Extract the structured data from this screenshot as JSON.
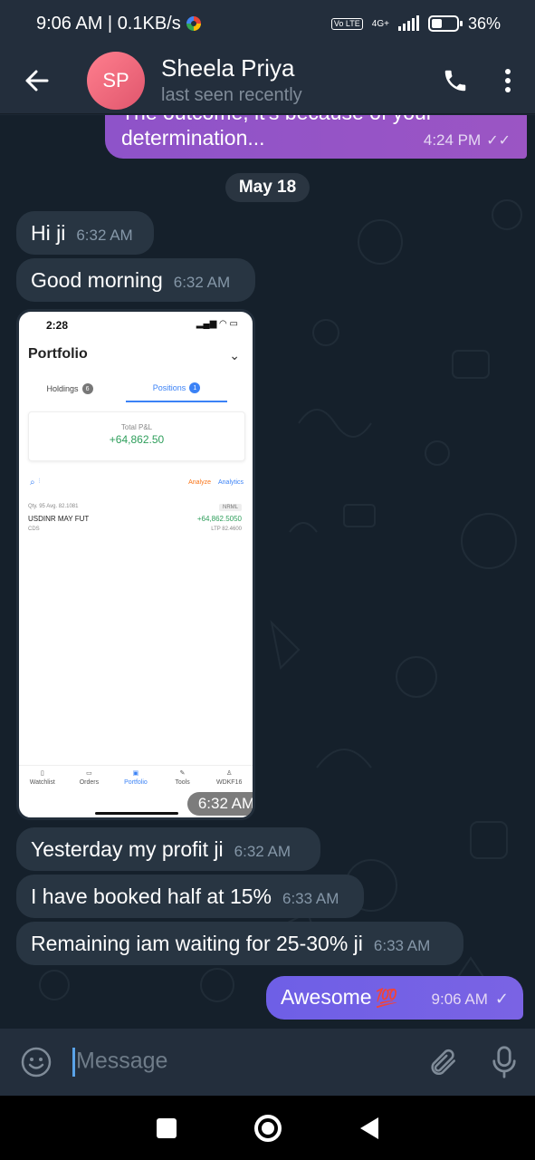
{
  "status_bar": {
    "time_speed": "9:06 AM | 0.1KB/s",
    "network_badge": "Vo LTE",
    "network_type": "4G+",
    "battery": "36%"
  },
  "header": {
    "avatar_initials": "SP",
    "name": "Sheela Priya",
    "status": "last seen recently"
  },
  "chat": {
    "prev_message": {
      "text_cut": "The outcome, it's because of your",
      "text": "determination...",
      "time": "4:24 PM"
    },
    "date_label": "May 18",
    "messages": [
      {
        "text": "Hi ji",
        "time": "6:32 AM"
      },
      {
        "text": "Good morning",
        "time": "6:32 AM"
      },
      {
        "text": "Yesterday my profit ji",
        "time": "6:32 AM"
      },
      {
        "text": "I have booked half at 15%",
        "time": "6:33 AM"
      },
      {
        "text": "Remaining iam waiting for 25-30% ji",
        "time": "6:33 AM"
      }
    ],
    "photo": {
      "time_label": "6:32 AM",
      "screen": {
        "clock": "2:28",
        "title": "Portfolio",
        "tab_holdings": "Holdings",
        "tab_holdings_count": "6",
        "tab_positions": "Positions",
        "tab_positions_count": "1",
        "pnl_label": "Total P&L",
        "pnl_value": "+64,862.50",
        "analyze": "Analyze",
        "analytics": "Analytics",
        "qty_line": "Qty. 95  Avg. 82.1081",
        "product": "NRML",
        "instrument": "USDINR MAY FUT",
        "instrument_pnl": "+64,862.5050",
        "exchange": "CDS",
        "ltp": "LTP 82.4600",
        "nav": [
          "Watchlist",
          "Orders",
          "Portfolio",
          "Tools",
          "WDKF16"
        ]
      }
    },
    "outgoing": {
      "text": "Awesome",
      "emoji": "💯",
      "time": "9:06 AM"
    }
  },
  "input": {
    "placeholder": "Message"
  },
  "colors": {
    "header_bg": "#232e3c",
    "chat_bg": "#15202b",
    "incoming_bubble": "#283542",
    "outgoing_bubble": "#8e53c9",
    "avatar": "#e0566d"
  }
}
